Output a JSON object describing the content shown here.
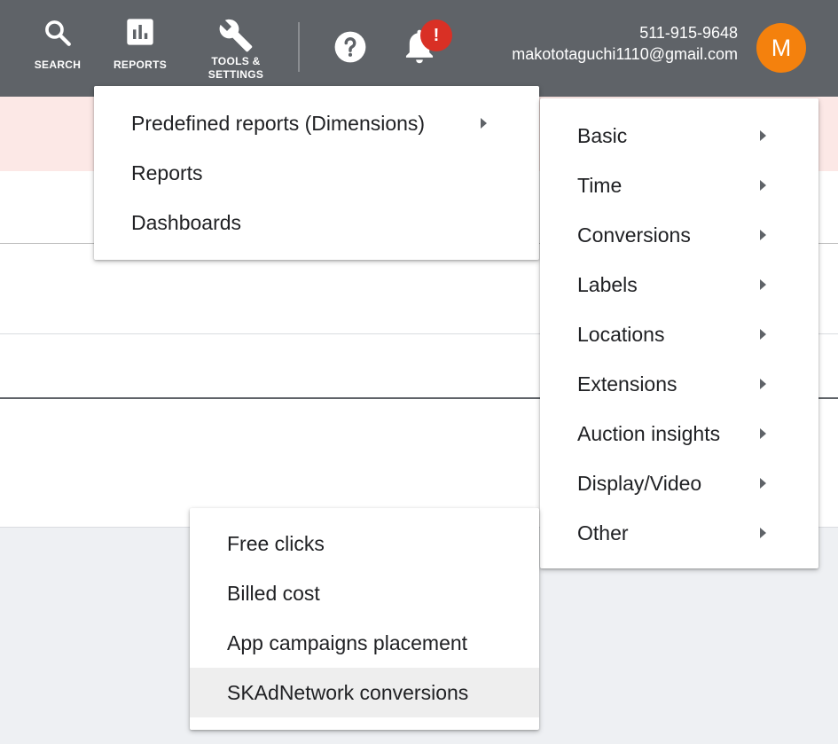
{
  "topbar": {
    "search_label": "SEARCH",
    "reports_label": "REPORTS",
    "tools_label_line1": "TOOLS &",
    "tools_label_line2": "SETTINGS",
    "notification_badge": "!",
    "account_phone": "511-915-9648",
    "account_email": "makototaguchi1110@gmail.com",
    "avatar_initial": "M",
    "colors": {
      "bar": "#5f6368",
      "avatar": "#f4810d",
      "badge": "#d93025"
    }
  },
  "reports_menu": {
    "items": [
      {
        "label": "Predefined reports (Dimensions)",
        "has_submenu": true
      },
      {
        "label": "Reports",
        "has_submenu": false
      },
      {
        "label": "Dashboards",
        "has_submenu": false
      }
    ]
  },
  "predefined_menu": {
    "items": [
      {
        "label": "Basic"
      },
      {
        "label": "Time"
      },
      {
        "label": "Conversions"
      },
      {
        "label": "Labels"
      },
      {
        "label": "Locations"
      },
      {
        "label": "Extensions"
      },
      {
        "label": "Auction insights"
      },
      {
        "label": "Display/Video"
      },
      {
        "label": "Other"
      }
    ]
  },
  "other_menu": {
    "items": [
      {
        "label": "Free clicks"
      },
      {
        "label": "Billed cost"
      },
      {
        "label": "App campaigns placement"
      },
      {
        "label": "SKAdNetwork conversions",
        "highlighted": true
      }
    ]
  }
}
